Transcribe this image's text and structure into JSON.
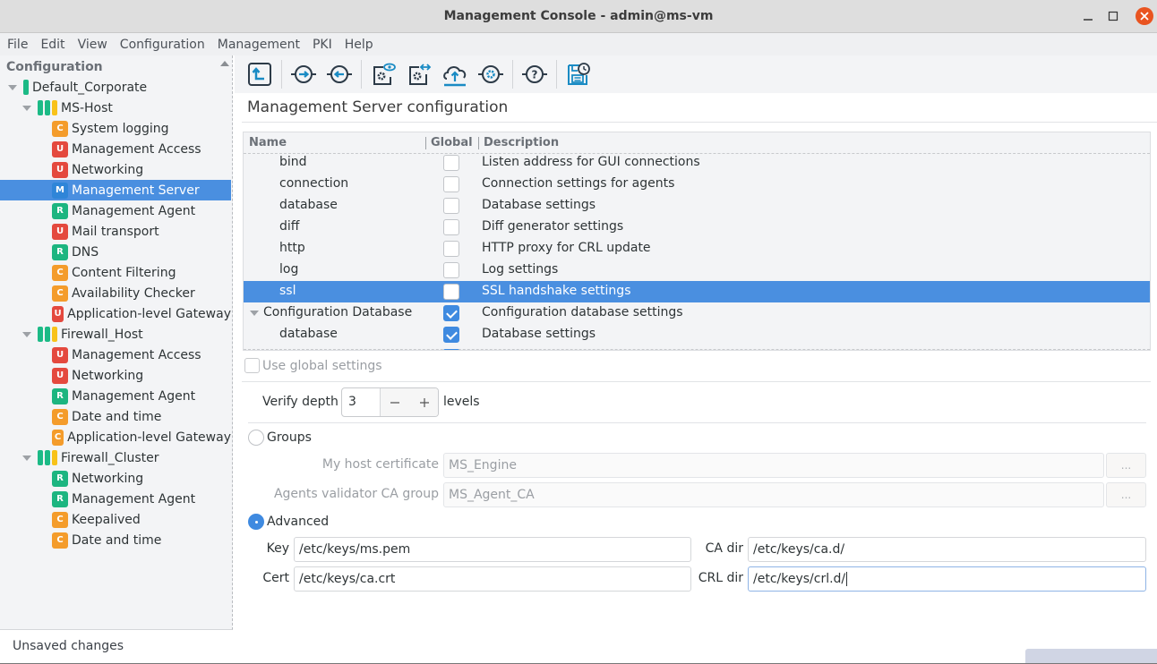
{
  "window": {
    "title": "Management Console - admin@ms-vm",
    "controls": {
      "minimize": "–",
      "maximize": "☐",
      "close": "✕"
    }
  },
  "menubar": [
    "File",
    "Edit",
    "View",
    "Configuration",
    "Management",
    "PKI",
    "Help"
  ],
  "sidebar": {
    "header": "Configuration",
    "tree": [
      {
        "level": 0,
        "type": "group",
        "label": "Default_Corporate",
        "status": [
          "green"
        ],
        "expanded": true
      },
      {
        "level": 1,
        "type": "host",
        "label": "MS-Host",
        "status": [
          "green",
          "green",
          "yellow"
        ],
        "expanded": true
      },
      {
        "level": 2,
        "type": "module",
        "badge": "C",
        "label": "System logging"
      },
      {
        "level": 2,
        "type": "module",
        "badge": "U",
        "label": "Management Access"
      },
      {
        "level": 2,
        "type": "module",
        "badge": "U",
        "label": "Networking"
      },
      {
        "level": 2,
        "type": "module",
        "badge": "M",
        "label": "Management Server",
        "selected": true
      },
      {
        "level": 2,
        "type": "module",
        "badge": "R",
        "label": "Management Agent"
      },
      {
        "level": 2,
        "type": "module",
        "badge": "U",
        "label": "Mail transport"
      },
      {
        "level": 2,
        "type": "module",
        "badge": "R",
        "label": "DNS"
      },
      {
        "level": 2,
        "type": "module",
        "badge": "C",
        "label": "Content Filtering"
      },
      {
        "level": 2,
        "type": "module",
        "badge": "C",
        "label": "Availability Checker"
      },
      {
        "level": 2,
        "type": "module",
        "badge": "U",
        "label": "Application-level Gateway"
      },
      {
        "level": 1,
        "type": "host",
        "label": "Firewall_Host",
        "status": [
          "green",
          "green",
          "yellow"
        ],
        "expanded": true
      },
      {
        "level": 2,
        "type": "module",
        "badge": "U",
        "label": "Management Access"
      },
      {
        "level": 2,
        "type": "module",
        "badge": "U",
        "label": "Networking"
      },
      {
        "level": 2,
        "type": "module",
        "badge": "R",
        "label": "Management Agent"
      },
      {
        "level": 2,
        "type": "module",
        "badge": "C",
        "label": "Date and time"
      },
      {
        "level": 2,
        "type": "module",
        "badge": "C",
        "label": "Application-level Gateway"
      },
      {
        "level": 1,
        "type": "host",
        "label": "Firewall_Cluster",
        "status": [
          "green",
          "green",
          "yellow"
        ],
        "expanded": true
      },
      {
        "level": 2,
        "type": "module",
        "badge": "R",
        "label": "Networking"
      },
      {
        "level": 2,
        "type": "module",
        "badge": "R",
        "label": "Management Agent"
      },
      {
        "level": 2,
        "type": "module",
        "badge": "C",
        "label": "Keepalived"
      },
      {
        "level": 2,
        "type": "module",
        "badge": "C",
        "label": "Date and time"
      }
    ]
  },
  "toolbar": {
    "buttons": [
      {
        "icon": "go-up-icon"
      },
      {
        "separator": true
      },
      {
        "icon": "push-right-icon"
      },
      {
        "icon": "pull-left-icon"
      },
      {
        "separator": true
      },
      {
        "icon": "view-config-icon"
      },
      {
        "icon": "compare-config-icon"
      },
      {
        "icon": "upload-icon"
      },
      {
        "icon": "apply-settings-icon"
      },
      {
        "separator": true
      },
      {
        "icon": "help-icon"
      },
      {
        "separator": true
      },
      {
        "icon": "save-history-icon"
      }
    ]
  },
  "main": {
    "title": "Management Server configuration",
    "table": {
      "columns": [
        "Name",
        "Global",
        "Description"
      ],
      "rows": [
        {
          "name": "bind",
          "indent": 1,
          "global": false,
          "description": "Listen address for GUI connections"
        },
        {
          "name": "connection",
          "indent": 1,
          "global": false,
          "description": "Connection settings for agents"
        },
        {
          "name": "database",
          "indent": 1,
          "global": false,
          "description": "Database settings"
        },
        {
          "name": "diff",
          "indent": 1,
          "global": false,
          "description": "Diff generator settings"
        },
        {
          "name": "http",
          "indent": 1,
          "global": false,
          "description": "HTTP proxy for CRL update"
        },
        {
          "name": "log",
          "indent": 1,
          "global": false,
          "description": "Log settings"
        },
        {
          "name": "ssl",
          "indent": 1,
          "global": false,
          "description": "SSL handshake settings",
          "selected": true
        },
        {
          "name": "Configuration Database",
          "indent": 0,
          "expander": true,
          "global": true,
          "description": "Configuration database settings"
        },
        {
          "name": "database",
          "indent": 1,
          "global": true,
          "description": "Database settings"
        }
      ]
    },
    "use_global_settings": {
      "label": "Use global settings",
      "checked": false
    },
    "verify_depth": {
      "label": "Verify depth",
      "value": "3",
      "unit": "levels",
      "decrement": "—",
      "increment": "+"
    },
    "groups": {
      "label": "Groups",
      "selected": false,
      "my_host_certificate": {
        "label": "My host certificate",
        "value": "MS_Engine",
        "browse": "..."
      },
      "agents_validator_ca_group": {
        "label": "Agents validator CA group",
        "value": "MS_Agent_CA",
        "browse": "..."
      }
    },
    "advanced": {
      "label": "Advanced",
      "selected": true,
      "key": {
        "label": "Key",
        "value": "/etc/keys/ms.pem"
      },
      "cert": {
        "label": "Cert",
        "value": "/etc/keys/ca.crt"
      },
      "ca_dir": {
        "label": "CA dir",
        "value": "/etc/keys/ca.d/"
      },
      "crl_dir": {
        "label": "CRL dir",
        "value": "/etc/keys/crl.d/"
      }
    }
  },
  "statusbar": {
    "text": "Unsaved changes"
  },
  "colors": {
    "accent": "#4a8fe0",
    "badge_C": "#f49c2b",
    "badge_U": "#e4493e",
    "badge_R": "#1cb580",
    "badge_M": "#2f85d8",
    "status_green": "#1cba86",
    "status_yellow": "#f8c21a",
    "close_button": "#e95420",
    "icon_blue": "#1a8bc4"
  }
}
